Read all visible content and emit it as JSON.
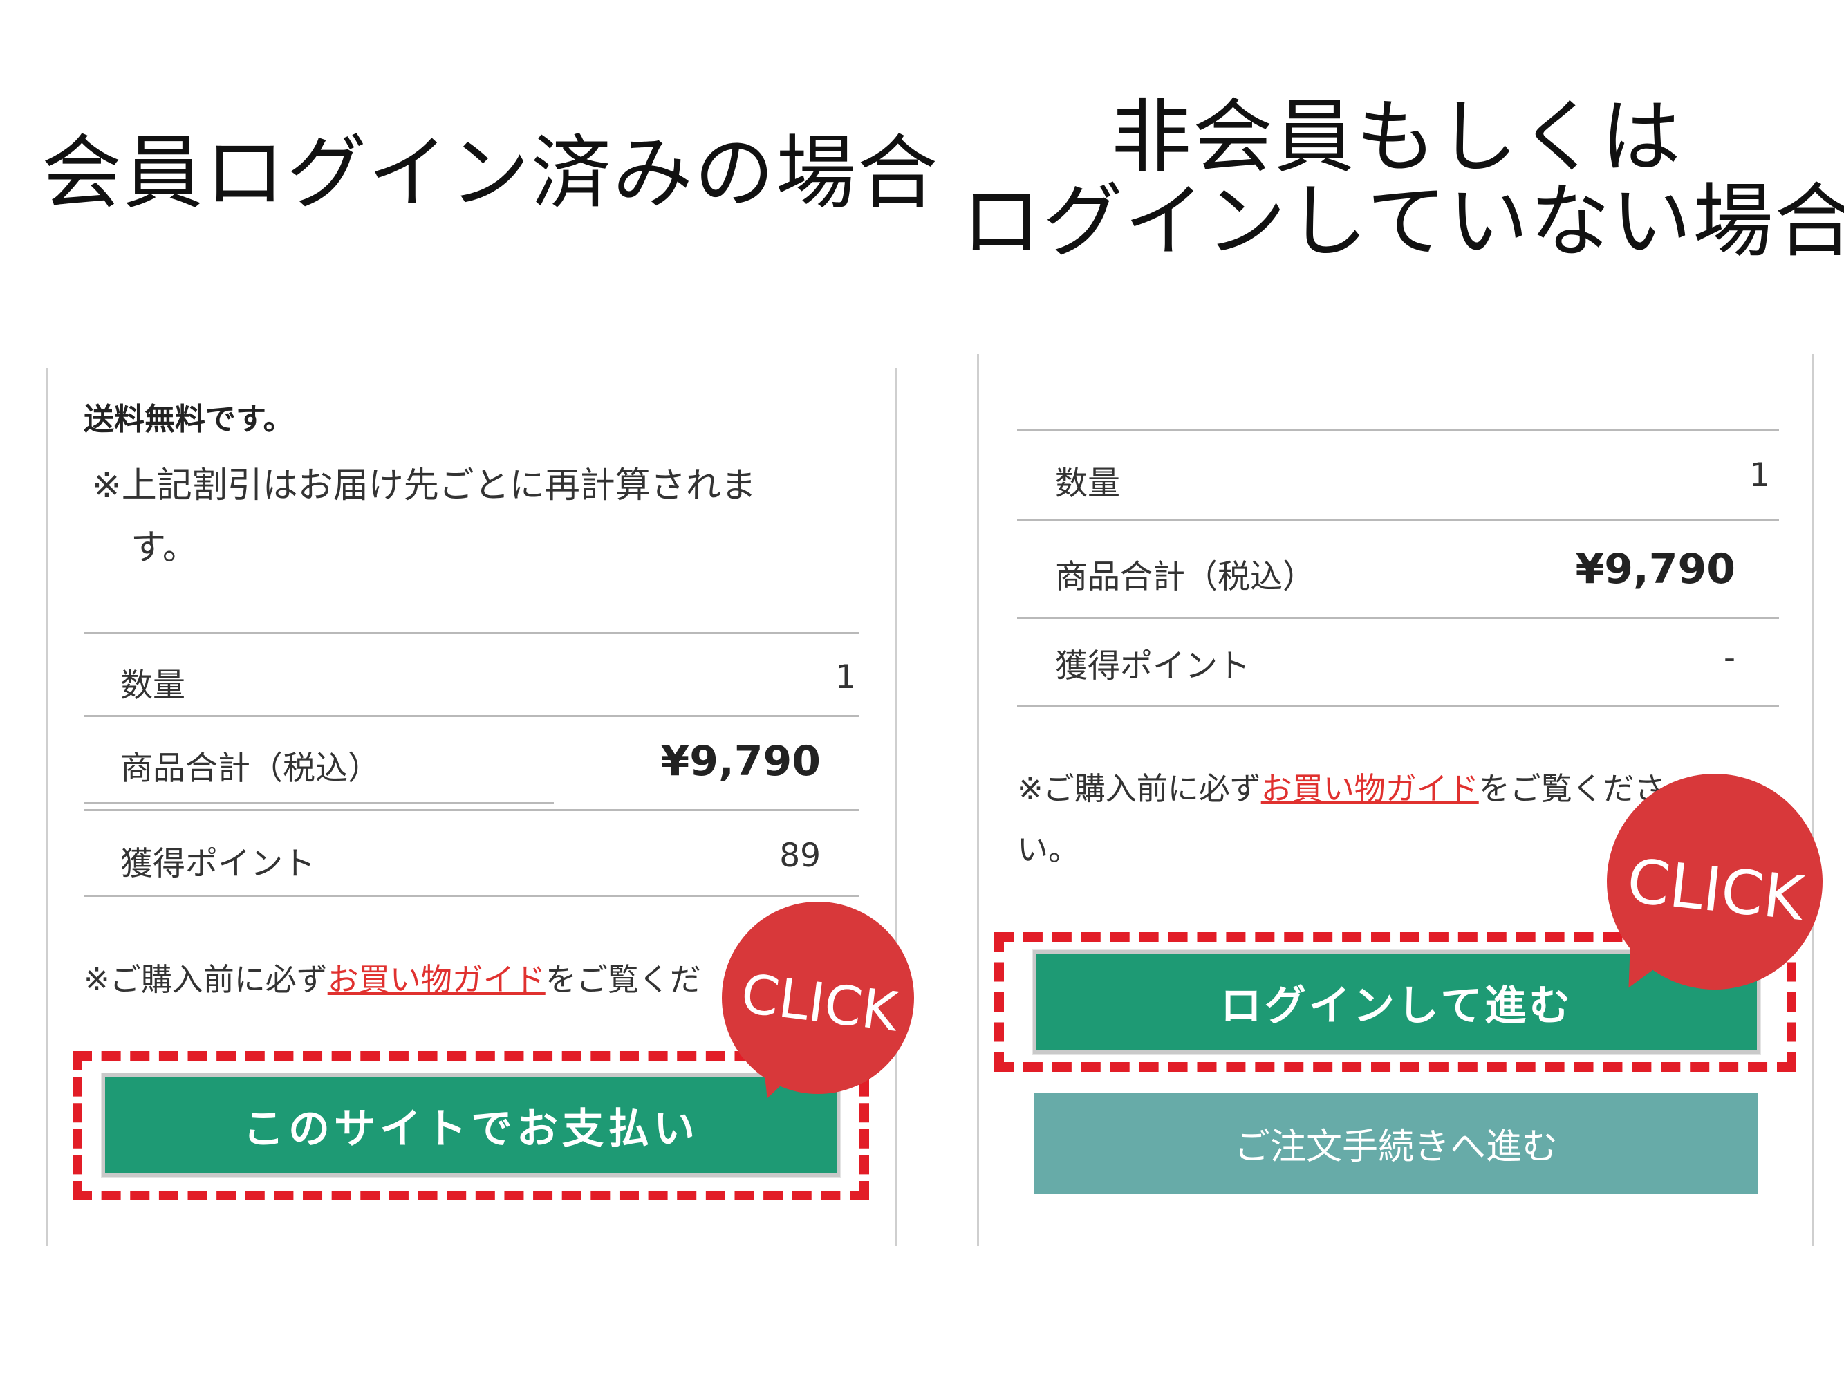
{
  "headings": {
    "left": "会員ログイン済みの場合",
    "right_line1": "非会員もしくは",
    "right_line2": "ログインしていない場合"
  },
  "left_panel": {
    "shipping_free": "送料無料です。",
    "recalc_note_line1": "※上記割引はお届け先ごとに再計算されま",
    "recalc_note_line2": "す。",
    "rows": [
      {
        "label": "数量",
        "value": "1"
      },
      {
        "label": "商品合計（税込）",
        "value": "¥9,790"
      },
      {
        "label": "獲得ポイント",
        "value": "89"
      }
    ],
    "guide_note": {
      "prefix": "※ご購入前に必ず",
      "link": "お買い物ガイド",
      "suffix": "をご覧くだ"
    },
    "pay_button": "このサイトでお支払い",
    "click_badge": "CLICK"
  },
  "right_panel": {
    "rows": [
      {
        "label": "数量",
        "value": "1"
      },
      {
        "label": "商品合計（税込）",
        "value": "¥9,790"
      },
      {
        "label": "獲得ポイント",
        "value": "-"
      }
    ],
    "guide_note": {
      "prefix": "※ご購入前に必ず",
      "link": "お買い物ガイド",
      "suffix": "をご覧くださ",
      "line2": "い。"
    },
    "login_button": "ログインして進む",
    "order_button": "ご注文手続きへ進む",
    "click_badge": "CLICK"
  },
  "colors": {
    "primary_button": "#1e9a74",
    "secondary_button": "#67aba8",
    "highlight_dash": "#e21d27",
    "click_badge": "#d8383a",
    "link": "#e0312f"
  }
}
